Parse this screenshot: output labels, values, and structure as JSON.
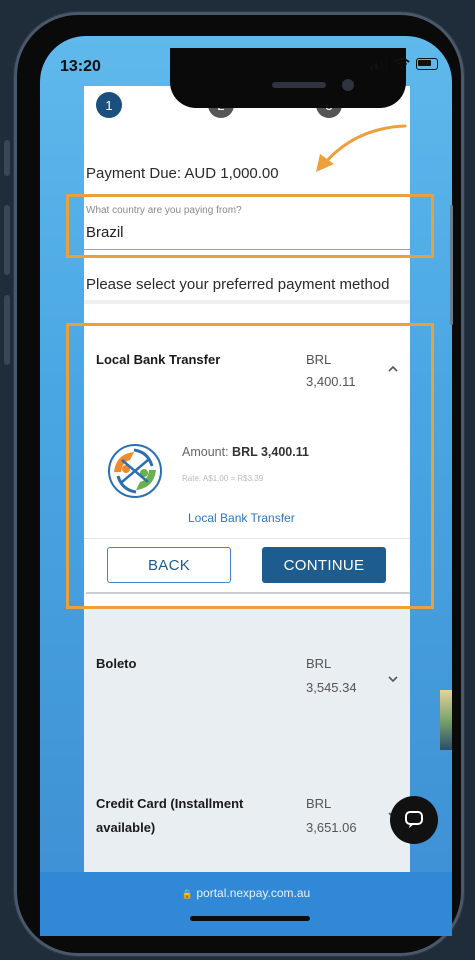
{
  "status": {
    "time": "13:20"
  },
  "steps": [
    "1",
    "2",
    "3"
  ],
  "payment_due": "Payment Due: AUD 1,000.00",
  "country": {
    "label": "What country are you paying from?",
    "value": "Brazil"
  },
  "prompt": "Please select your preferred payment method",
  "methods": [
    {
      "name": "Local Bank Transfer",
      "currency": "BRL",
      "amount": "3,400.11",
      "expanded": true,
      "detail": {
        "amount_label": "Amount:",
        "amount_value": "BRL 3,400.11",
        "rate": "Rate: A$1.00 = R$3.39",
        "link": "Local Bank Transfer"
      }
    },
    {
      "name": "Boleto",
      "currency": "BRL",
      "amount": "3,545.34",
      "expanded": false
    },
    {
      "name": "Credit Card (Installment available)",
      "name_line1": "Credit Card (Installment",
      "name_line2": "available)",
      "currency": "BRL",
      "amount": "3,651.06",
      "expanded": false
    }
  ],
  "buttons": {
    "back": "BACK",
    "continue": "CONTINUE"
  },
  "url": "portal.nexpay.com.au",
  "colors": {
    "step_active": "#1a4f7e",
    "step_inactive": "#555555",
    "highlight": "#eba03a",
    "continue_bg": "#1d5c8e",
    "back_border": "#3b87c9",
    "link": "#2a76c4",
    "screen_bg": "#4aa6e3",
    "chat_bg": "#111111"
  },
  "icons": [
    "signal-icon",
    "wifi-icon",
    "battery-icon",
    "chevron-up-icon",
    "chevron-down-icon",
    "chat-icon",
    "lock-icon",
    "curved-arrow-icon",
    "bank-transfer-logo"
  ]
}
